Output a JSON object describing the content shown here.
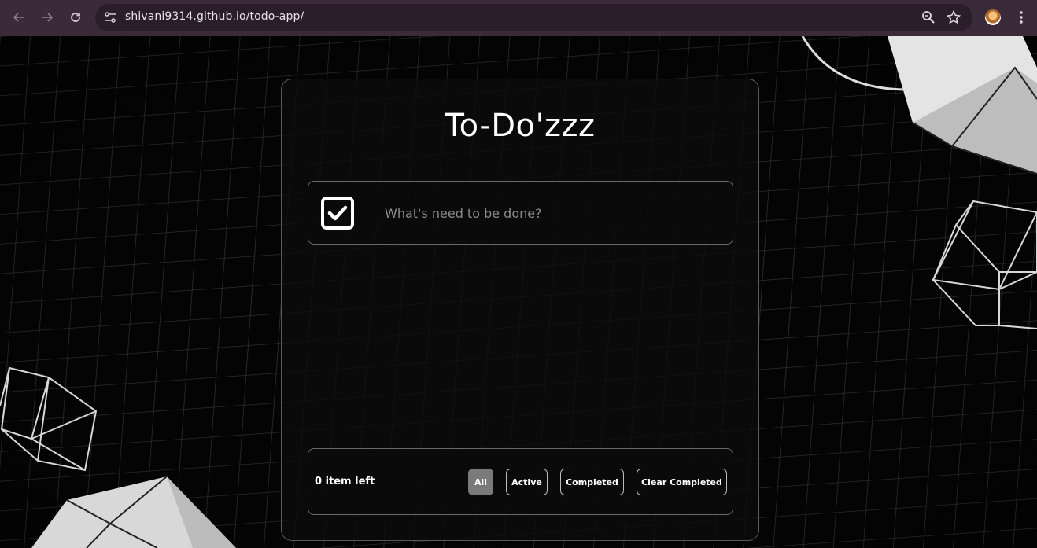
{
  "browser": {
    "url": "shivani9314.github.io/todo-app/"
  },
  "app": {
    "title": "To-Do'zzz",
    "input_placeholder": "What's need to be done?",
    "items_left": "0 item left",
    "filters": {
      "all": "All",
      "active": "Active",
      "completed": "Completed",
      "clear_completed": "Clear Completed"
    },
    "selected_filter": "All"
  },
  "icons": {
    "back": "arrow-left-icon",
    "forward": "arrow-right-icon",
    "reload": "reload-icon",
    "site_info": "tune-icon",
    "zoom": "zoom-icon",
    "bookmark": "star-icon",
    "avatar": "profile-avatar",
    "menu": "kebab-menu-icon",
    "todo_check": "checkbox-check-icon"
  },
  "colors": {
    "chrome_bg": "#3a2a3a",
    "omnibox_bg": "#2a1e2a",
    "page_bg": "#050505",
    "card_border": "#5a5a5a",
    "selected_filter_bg": "#7a7a7a"
  }
}
